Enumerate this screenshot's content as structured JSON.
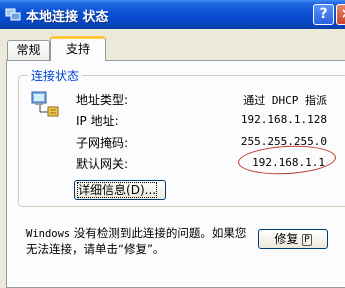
{
  "window": {
    "title": "本地连接 状态",
    "help_button": "?",
    "close_button": "×"
  },
  "tabs": [
    {
      "label": "常规",
      "active": false
    },
    {
      "label": "支持",
      "active": true
    }
  ],
  "connection_status": {
    "group_label": "连接状态",
    "rows": [
      {
        "label": "地址类型:",
        "value": "通过 DHCP 指派"
      },
      {
        "label": "IP 地址:",
        "value": "192.168.1.128"
      },
      {
        "label": "子网掩码:",
        "value": "255.255.255.0"
      },
      {
        "label": "默认网关:",
        "value": "192.168.1.1"
      }
    ],
    "details_button": {
      "label": "详细信息",
      "accesskey": "D",
      "suffix": "..."
    }
  },
  "footer": {
    "message_prefix": "Windows",
    "message_rest": " 没有检测到此连接的问题。如果您无法连接，请单击“修复”。",
    "repair_button": {
      "label": "修复",
      "accesskey": "P"
    }
  },
  "colors": {
    "titlebar": "#0a4fd3",
    "group_label": "#0046d5",
    "highlight_ellipse": "#c0392b",
    "tab_accent": "#ffc83c"
  }
}
